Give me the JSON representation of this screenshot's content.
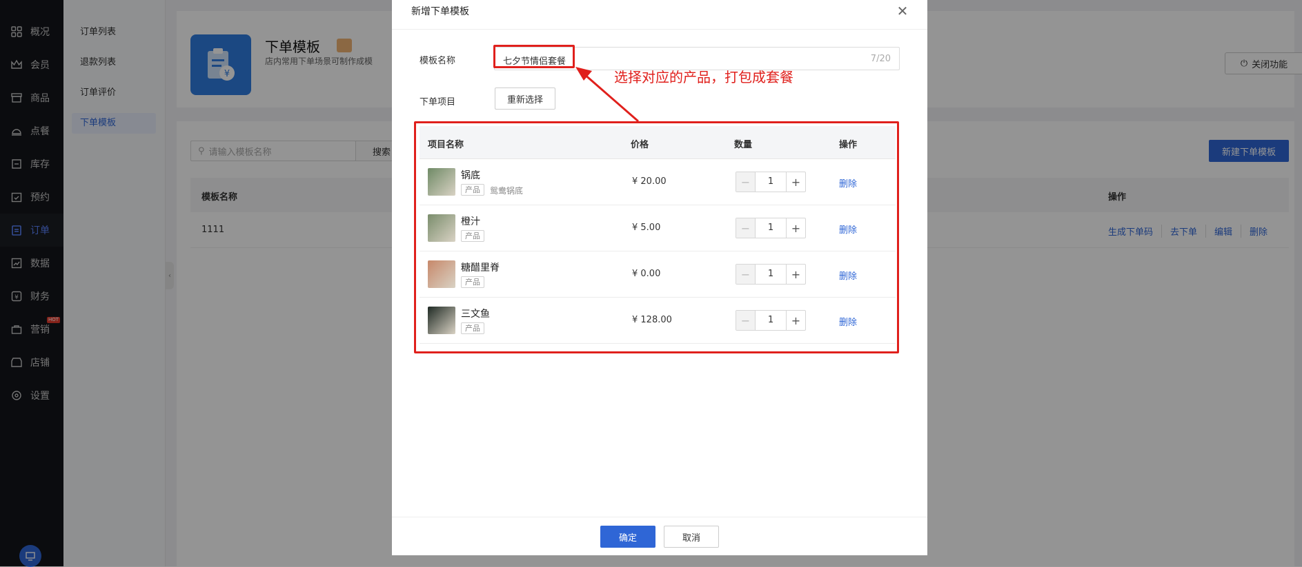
{
  "nav": {
    "items": [
      {
        "label": "概况",
        "icon": "grid-icon"
      },
      {
        "label": "会员",
        "icon": "crown-icon"
      },
      {
        "label": "商品",
        "icon": "store-icon"
      },
      {
        "label": "点餐",
        "icon": "food-tray-icon"
      },
      {
        "label": "库存",
        "icon": "inventory-icon"
      },
      {
        "label": "预约",
        "icon": "calendar-check-icon"
      },
      {
        "label": "订单",
        "icon": "clipboard-icon"
      },
      {
        "label": "数据",
        "icon": "chart-icon"
      },
      {
        "label": "财务",
        "icon": "yen-icon"
      },
      {
        "label": "营销",
        "icon": "marketing-icon"
      },
      {
        "label": "店铺",
        "icon": "shop-icon"
      },
      {
        "label": "设置",
        "icon": "gear-icon"
      }
    ],
    "active": "订单",
    "hot_label": "HOT"
  },
  "submenu": {
    "items": [
      "订单列表",
      "退款列表",
      "订单评价",
      "下单模板"
    ],
    "active": "下单模板"
  },
  "header": {
    "title": "下单模板",
    "description": "店内常用下单场景可制作成模",
    "close_feature_label": "关闭功能"
  },
  "list": {
    "search_placeholder": "请输入模板名称",
    "search_button": "搜索",
    "new_button": "新建下单模板",
    "columns": {
      "name": "模板名称",
      "ops": "操作"
    },
    "rows": [
      {
        "name": "1111",
        "ops": [
          "生成下单码",
          "去下单",
          "编辑",
          "删除"
        ]
      }
    ]
  },
  "modal": {
    "title": "新增下单模板",
    "name_label": "模板名称",
    "name_value": "七夕节情侣套餐",
    "name_counter": "7/20",
    "items_label": "下单项目",
    "reselect_button": "重新选择",
    "table_headers": {
      "name": "项目名称",
      "price": "价格",
      "qty": "数量",
      "op": "操作"
    },
    "rows": [
      {
        "name": "锅底",
        "tag": "产品",
        "note": "鸳鸯锅底",
        "price": "¥ 20.00",
        "qty": "1",
        "op": "删除",
        "thumb_color": "#6f8a66"
      },
      {
        "name": "橙汁",
        "tag": "产品",
        "note": "",
        "price": "¥ 5.00",
        "qty": "1",
        "op": "删除",
        "thumb_color": "#7a8d6c"
      },
      {
        "name": "糖醋里脊",
        "tag": "产品",
        "note": "",
        "price": "¥ 0.00",
        "qty": "1",
        "op": "删除",
        "thumb_color": "#c7886a"
      },
      {
        "name": "三文鱼",
        "tag": "产品",
        "note": "",
        "price": "¥ 128.00",
        "qty": "1",
        "op": "删除",
        "thumb_color": "#1f2a24"
      }
    ],
    "ok_button": "确定",
    "cancel_button": "取消"
  },
  "annotation": {
    "text": "选择对应的产品，打包成套餐",
    "color": "#e0201c"
  },
  "colors": {
    "accent": "#2f66d6",
    "nav_bg": "#13161b"
  }
}
